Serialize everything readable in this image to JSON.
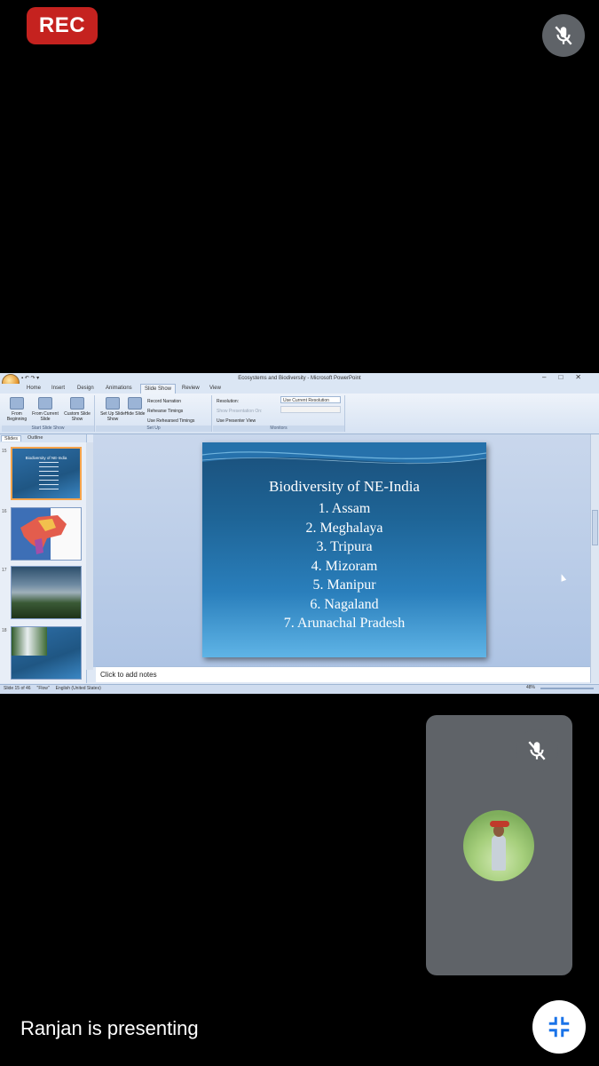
{
  "recording_badge": "REC",
  "window_title": "Ecosystems and Biodiversity - Microsoft PowerPoint",
  "ribbon_tabs": [
    "Home",
    "Insert",
    "Design",
    "Animations",
    "Slide Show",
    "Review",
    "View"
  ],
  "active_tab": "Slide Show",
  "ribbon": {
    "from_beginning": "From Beginning",
    "from_current": "From Current Slide",
    "custom_show": "Custom Slide Show",
    "group_start": "Start Slide Show",
    "setup_show": "Set Up Slide Show",
    "hide_slide": "Hide Slide",
    "record_narration": "Record Narration",
    "rehearse": "Rehearse Timings",
    "use_rehearsed": "Use Rehearsed Timings",
    "group_setup": "Set Up",
    "resolution": "Resolution:",
    "resolution_value": "Use Current Resolution",
    "show_on": "Show Presentation On:",
    "presenter_view": "Use Presenter View",
    "group_monitors": "Monitors"
  },
  "panel_tabs": [
    "Slides",
    "Outline"
  ],
  "thumb_numbers": [
    "15",
    "16",
    "17",
    "18"
  ],
  "thumb_title": "Biodiversity of NE-India",
  "slide": {
    "title": "Biodiversity of NE-India",
    "items": [
      "1.   Assam",
      "2.   Meghalaya",
      "3.   Tripura",
      "4.   Mizoram",
      "5.   Manipur",
      "6.   Nagaland",
      "7.   Arunachal Pradesh"
    ]
  },
  "notes_placeholder": "Click to add notes",
  "status": {
    "slide_info": "Slide 15 of 46",
    "theme": "\"Flow\"",
    "language": "English (United States)",
    "zoom": "48%"
  },
  "presenter_text": "Ranjan is presenting",
  "colors": {
    "rec_red": "#c5221f",
    "tile_gray": "#5f6368",
    "mic_button_gray": "#5f6368"
  },
  "icons": {
    "mic_muted": "mic-off-icon",
    "fullscreen_exit": "fullscreen-exit-icon"
  }
}
